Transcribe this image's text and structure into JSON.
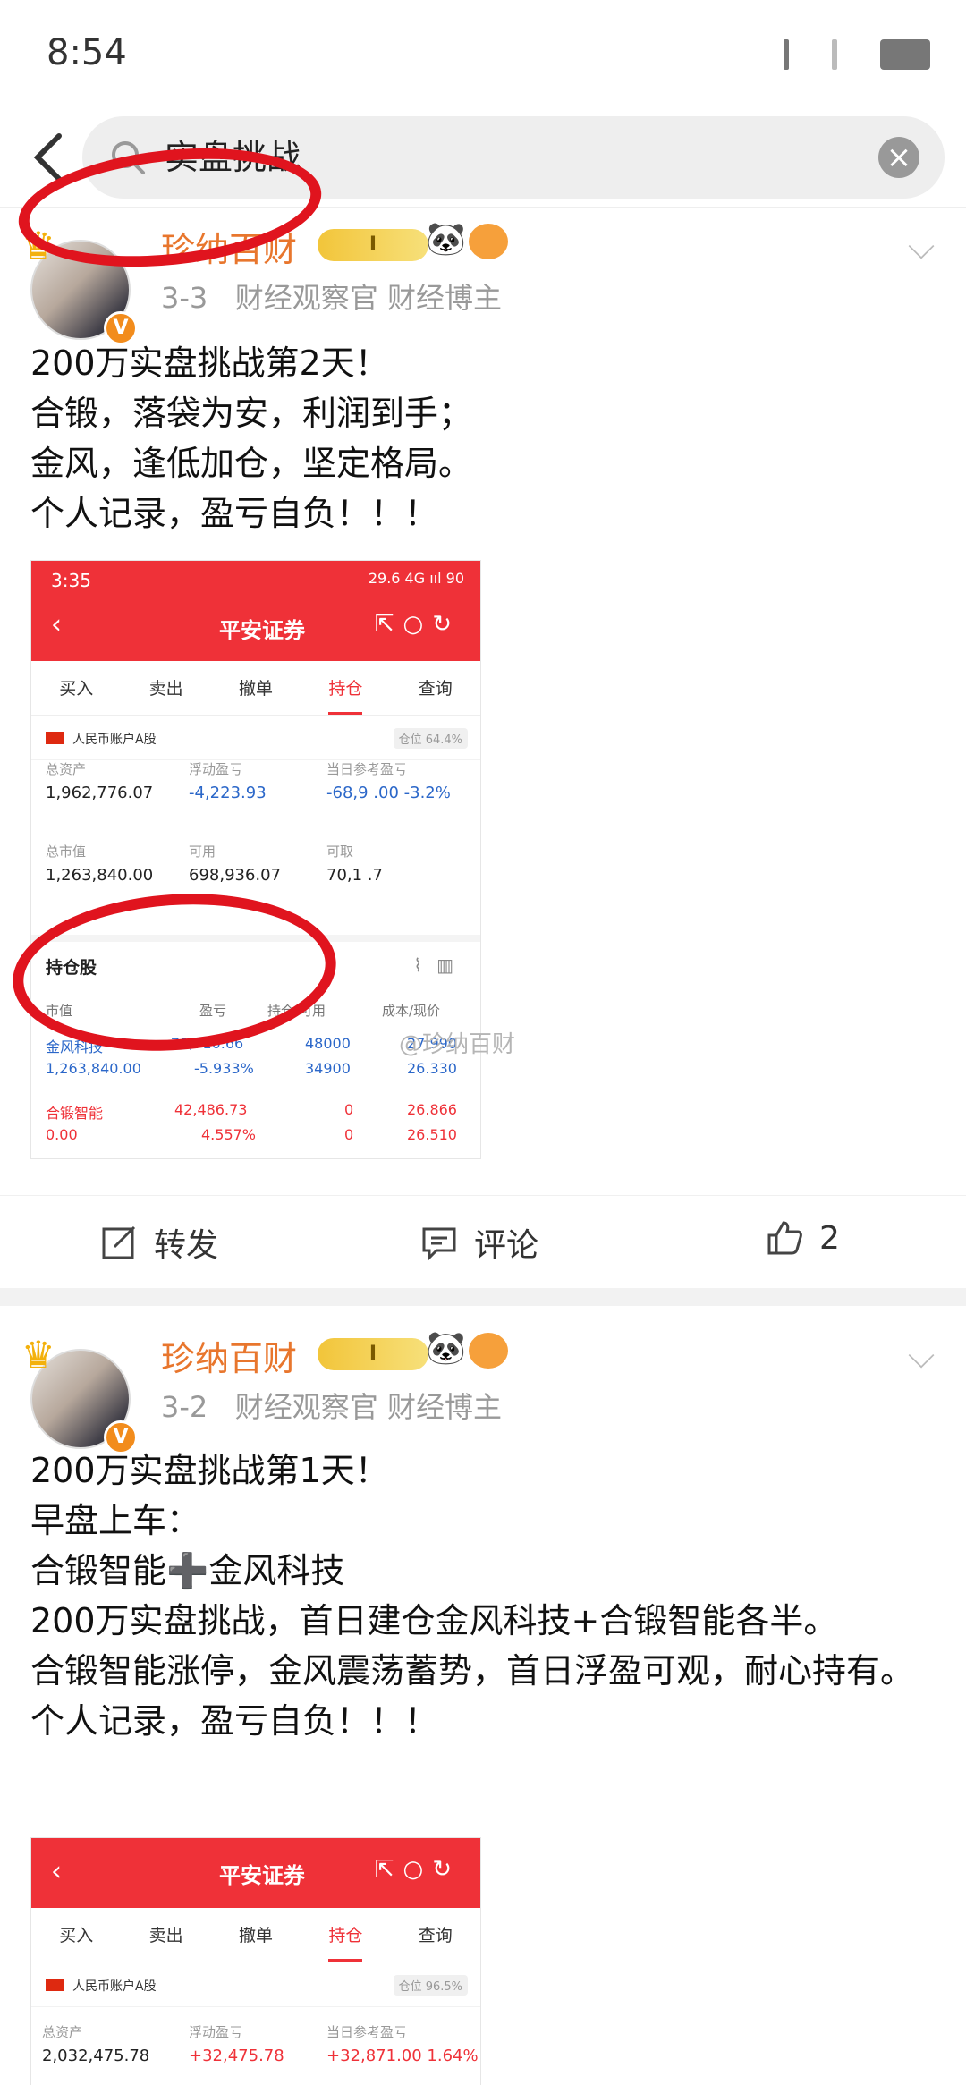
{
  "status": {
    "time": "8:54"
  },
  "search": {
    "query": "实盘挑战"
  },
  "posts": [
    {
      "author": "珍纳百财",
      "level": "I",
      "date": "3-3",
      "tags": "财经观察官 财经博主",
      "text": [
        "200万实盘挑战第2天！",
        "合锻，落袋为安，利润到手；",
        "金风，逢低加仓，坚定格局。",
        "个人记录，盈亏自负！！！"
      ],
      "screenshot": {
        "time": "3:35",
        "sys": "29.6 4G ııl 90",
        "title": "平安证券",
        "tabs": [
          "买入",
          "卖出",
          "撤单",
          "持仓",
          "查询"
        ],
        "active_tab": "持仓",
        "account": "人民币账户A股",
        "cangwei": "仓位 64.4%",
        "kpis": [
          {
            "label": "总资产",
            "value": "1,962,776.07"
          },
          {
            "label": "浮动盈亏",
            "value": "-4,223.93"
          },
          {
            "label": "当日参考盈亏",
            "value": "-68,9 .00 -3.2%"
          },
          {
            "label": "总市值",
            "value": "1,263,840.00"
          },
          {
            "label": "可用",
            "value": "698,936.07"
          },
          {
            "label": "可取",
            "value": "70,1 .7"
          }
        ],
        "holdings_title": "持仓股",
        "columns": [
          "市值",
          "盈亏",
          "持仓/可用",
          "成本/现价"
        ],
        "rows": [
          {
            "name": "金风科技",
            "pnl": "-79,710.66",
            "position": "48000",
            "cost": "27.990",
            "value": "1,263,840.00",
            "pnl_pct": "-5.933%",
            "available": "34900",
            "price": "26.330"
          },
          {
            "name": "合锻智能",
            "pnl": "42,486.73",
            "position": "0",
            "cost": "26.866",
            "value": "0.00",
            "pnl_pct": "4.557%",
            "available": "0",
            "price": "26.510"
          }
        ]
      },
      "watermark": "@珍纳百财",
      "actions": {
        "repost": "转发",
        "comment": "评论",
        "likes": "2"
      }
    },
    {
      "author": "珍纳百财",
      "level": "I",
      "date": "3-2",
      "tags": "财经观察官 财经博主",
      "text": [
        "200万实盘挑战第1天！",
        "早盘上车：",
        "合锻智能➕金风科技",
        "200万实盘挑战，首日建仓金风科技+合锻智能各半。",
        "合锻智能涨停，金风震荡蓄势，首日浮盈可观，耐心持有。",
        "个人记录，盈亏自负！！！"
      ],
      "screenshot": {
        "title": "平安证券",
        "tabs": [
          "买入",
          "卖出",
          "撤单",
          "持仓",
          "查询"
        ],
        "active_tab": "持仓",
        "account": "人民币账户A股",
        "cangwei": "仓位 96.5%",
        "kpis": [
          {
            "label": "总资产",
            "value": "2,032,475.78"
          },
          {
            "label": "浮动盈亏",
            "value": "+32,475.78"
          },
          {
            "label": "当日参考盈亏",
            "value": "+32,871.00 1.64%"
          }
        ]
      }
    }
  ]
}
